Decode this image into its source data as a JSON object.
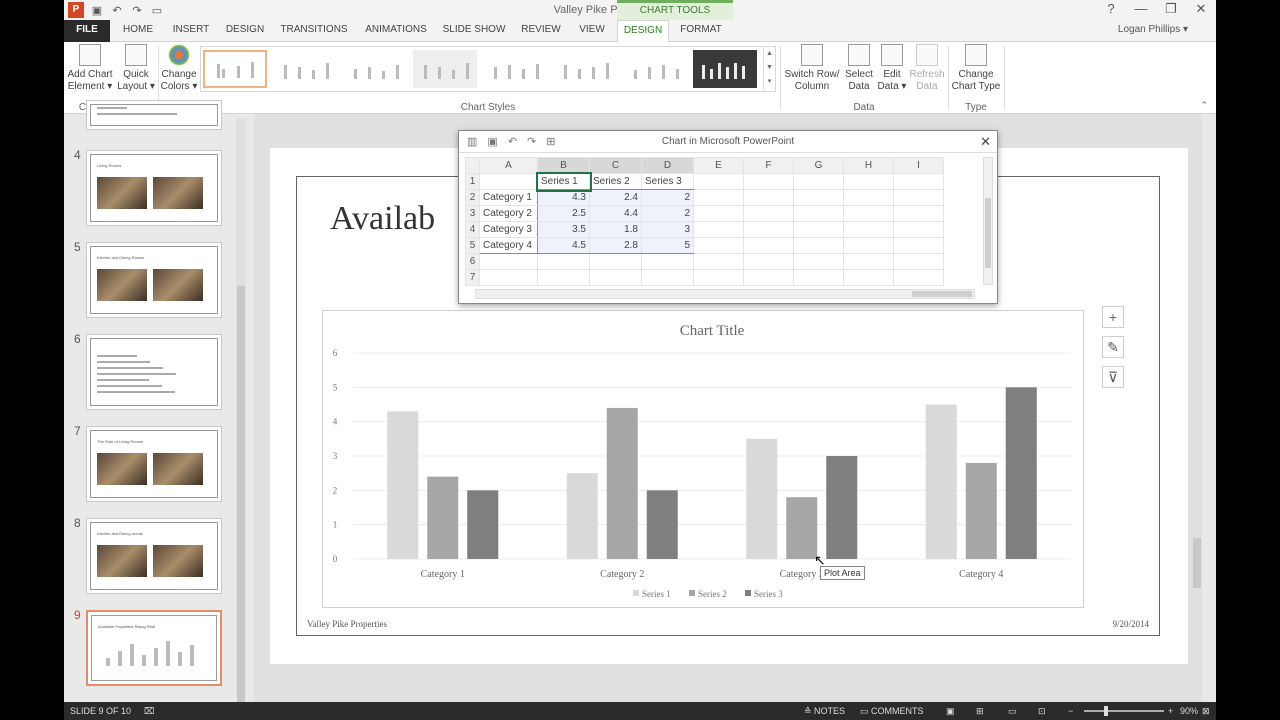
{
  "titlebar": {
    "title": "Valley Pike Properties - PowerPoint",
    "context_group": "CHART TOOLS",
    "help": "?",
    "minimize": "—",
    "restore": "❐",
    "close": "✕"
  },
  "tabs": {
    "file": "FILE",
    "home": "HOME",
    "insert": "INSERT",
    "design": "DESIGN",
    "transitions": "TRANSITIONS",
    "animations": "ANIMATIONS",
    "slide_show": "SLIDE SHOW",
    "review": "REVIEW",
    "view": "VIEW",
    "chart_design": "DESIGN",
    "chart_format": "FORMAT"
  },
  "user": {
    "name": "Logan Phillips ▾"
  },
  "ribbon": {
    "add_chart_element": [
      "Add Chart",
      "Element ▾"
    ],
    "quick_layout": [
      "Quick",
      "Layout ▾"
    ],
    "change_colors": [
      "Change",
      "Colors ▾"
    ],
    "group_chart_layouts": "Chart Layouts",
    "group_chart_styles": "Chart Styles",
    "switch_row_column": [
      "Switch Row/",
      "Column"
    ],
    "select_data": [
      "Select",
      "Data"
    ],
    "edit_data": [
      "Edit",
      "Data ▾"
    ],
    "refresh_data": [
      "Refresh",
      "Data"
    ],
    "group_data": "Data",
    "change_chart_type": [
      "Change",
      "Chart Type"
    ],
    "group_type": "Type"
  },
  "thumbnails": [
    {
      "num": "4",
      "title": "Living Rooms",
      "photos": 2
    },
    {
      "num": "5",
      "title": "Kitchen and Dining Rooms",
      "photos": 2
    },
    {
      "num": "6",
      "title": "",
      "photos": 0
    },
    {
      "num": "7",
      "title": "The Role of Living Rooms",
      "photos": 2
    },
    {
      "num": "8",
      "title": "Kitchen and Dining rooms",
      "photos": 2
    },
    {
      "num": "9",
      "title": "Available Properties Rising Real",
      "photos": 0
    }
  ],
  "slide": {
    "heading": "Availab",
    "footer_left": "Valley Pike Properties",
    "footer_right": "9/20/2014"
  },
  "sheet": {
    "title": "Chart in Microsoft PowerPoint",
    "close": "✕",
    "columns": [
      "",
      "A",
      "B",
      "C",
      "D",
      "E",
      "F",
      "G",
      "H",
      "I"
    ],
    "rows": [
      [
        "1",
        "",
        "Series 1",
        "Series 2",
        "Series 3",
        "",
        "",
        "",
        "",
        ""
      ],
      [
        "2",
        "Category 1",
        "4.3",
        "2.4",
        "2",
        "",
        "",
        "",
        "",
        ""
      ],
      [
        "3",
        "Category 2",
        "2.5",
        "4.4",
        "2",
        "",
        "",
        "",
        "",
        ""
      ],
      [
        "4",
        "Category 3",
        "3.5",
        "1.8",
        "3",
        "",
        "",
        "",
        "",
        ""
      ],
      [
        "5",
        "Category 4",
        "4.5",
        "2.8",
        "5",
        "",
        "",
        "",
        "",
        ""
      ],
      [
        "6",
        "",
        "",
        "",
        "",
        "",
        "",
        "",
        "",
        ""
      ],
      [
        "7",
        "",
        "",
        "",
        "",
        "",
        "",
        "",
        "",
        ""
      ]
    ]
  },
  "chart_side_buttons": {
    "elements": "+",
    "styles": "✎",
    "filters": "⊽"
  },
  "tooltip": "Plot Area",
  "status": {
    "slide_info": "SLIDE 9 OF 10",
    "notes": "≙ NOTES",
    "comments": "▭ COMMENTS",
    "zoom": "90%"
  },
  "chart_data": {
    "type": "bar",
    "title": "Chart Title",
    "categories": [
      "Category 1",
      "Category 2",
      "Category 3",
      "Category 4"
    ],
    "series": [
      {
        "name": "Series 1",
        "values": [
          4.3,
          2.5,
          3.5,
          4.5
        ],
        "color": "#d9d9d9"
      },
      {
        "name": "Series 2",
        "values": [
          2.4,
          4.4,
          1.8,
          2.8
        ],
        "color": "#a6a6a6"
      },
      {
        "name": "Series 3",
        "values": [
          2,
          2,
          3,
          5
        ],
        "color": "#7f7f7f"
      }
    ],
    "ylim": [
      0,
      6
    ],
    "yticks": [
      "0",
      "1",
      "2",
      "3",
      "4",
      "5",
      "6"
    ],
    "grid": true,
    "legend": "bottom"
  }
}
